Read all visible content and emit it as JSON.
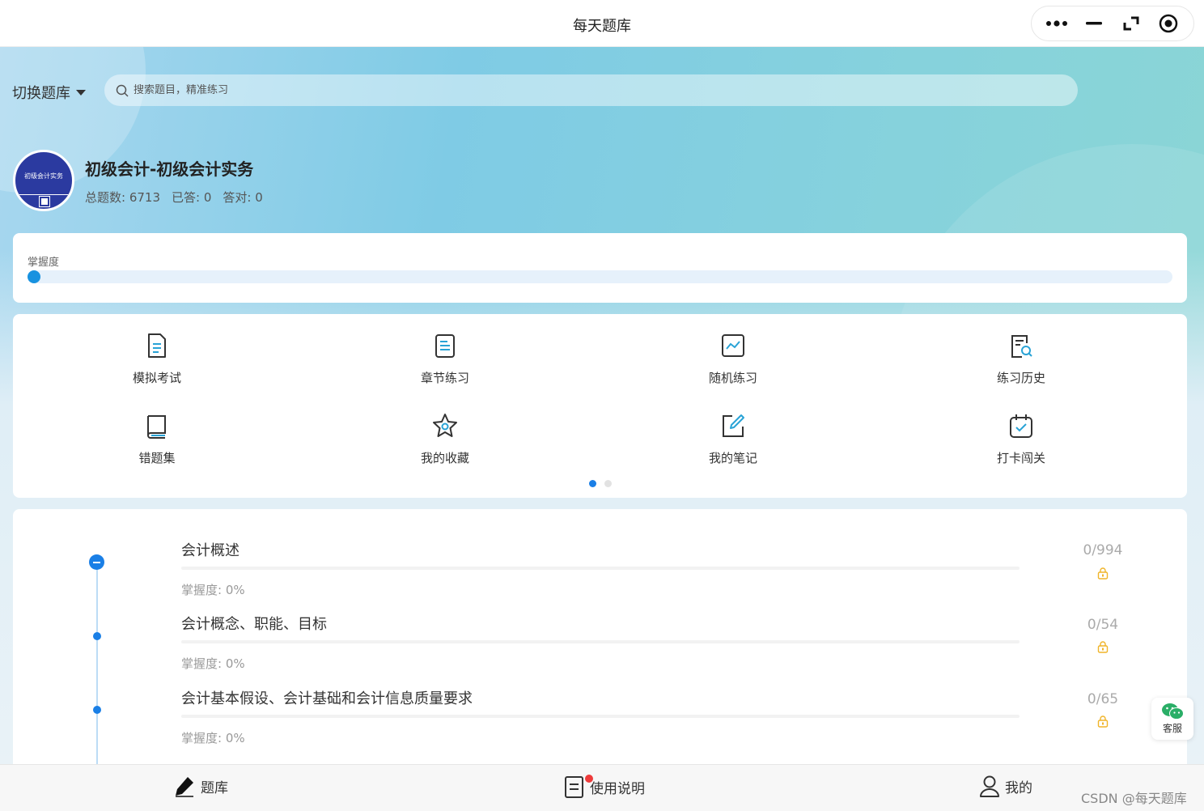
{
  "window": {
    "title": "每天题库"
  },
  "capsule": {
    "icons": [
      "more-icon",
      "minimize-icon",
      "restore-icon",
      "close-icon"
    ]
  },
  "header": {
    "switch_label": "切换题库",
    "search_placeholder": "搜索题目，精准练习"
  },
  "bank": {
    "avatar_text": "初级会计实务",
    "title": "初级会计-初级会计实务",
    "total": "总题数: 6713",
    "answered": "已答: 0",
    "correct": "答对: 0"
  },
  "mastery": {
    "label": "掌握度",
    "progress": 0.0
  },
  "functions": [
    {
      "label": "模拟考试",
      "icon": "exam-doc-icon"
    },
    {
      "label": "章节练习",
      "icon": "chapter-doc-icon"
    },
    {
      "label": "随机练习",
      "icon": "chart-line-icon"
    },
    {
      "label": "练习历史",
      "icon": "history-search-icon"
    },
    {
      "label": "错题集",
      "icon": "book-icon"
    },
    {
      "label": "我的收藏",
      "icon": "star-icon"
    },
    {
      "label": "我的笔记",
      "icon": "pencil-note-icon"
    },
    {
      "label": "打卡闯关",
      "icon": "calendar-check-icon"
    }
  ],
  "pager": {
    "pages": 2,
    "active": 0
  },
  "chapters": [
    {
      "name": "会计概述",
      "mastery": "掌握度: 0%",
      "count": "0/994"
    },
    {
      "name": "会计概念、职能、目标",
      "mastery": "掌握度: 0%",
      "count": "0/54"
    },
    {
      "name": "会计基本假设、会计基础和会计信息质量要求",
      "mastery": "掌握度: 0%",
      "count": "0/65"
    }
  ],
  "service": {
    "label": "客服"
  },
  "tabs": [
    {
      "label": "题库",
      "icon": "pencil-icon"
    },
    {
      "label": "使用说明",
      "icon": "document-icon"
    },
    {
      "label": "我的",
      "icon": "user-icon"
    }
  ],
  "watermark": "CSDN @每天题库",
  "colors": {
    "accent": "#1a7fe6",
    "lock": "#f0b429",
    "badge": "#ee3b3b"
  }
}
